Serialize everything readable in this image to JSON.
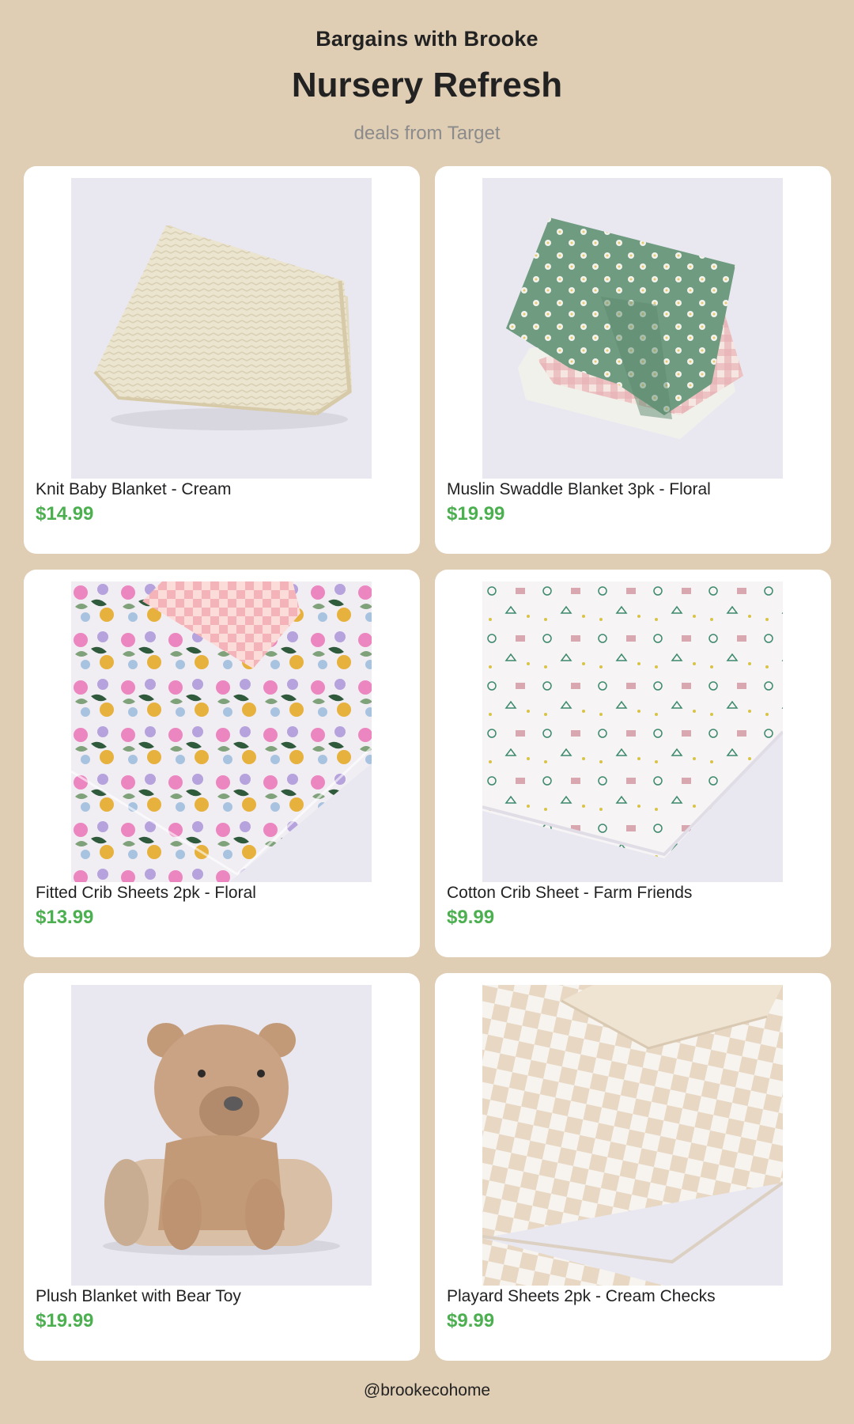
{
  "header": {
    "brand": "Bargains with Brooke",
    "title": "Nursery Refresh",
    "subtitle": "deals from Target"
  },
  "products": [
    {
      "name": "Knit Baby Blanket - Cream",
      "price": "$14.99",
      "image": "knit-blanket-image"
    },
    {
      "name": "Muslin Swaddle Blanket 3pk - Floral",
      "price": "$19.99",
      "image": "swaddle-blankets-image"
    },
    {
      "name": "Fitted Crib Sheets 2pk - Floral",
      "price": "$13.99",
      "image": "floral-crib-sheet-image"
    },
    {
      "name": "Cotton Crib Sheet - Farm Friends",
      "price": "$9.99",
      "image": "farm-crib-sheet-image"
    },
    {
      "name": "Plush Blanket with Bear Toy",
      "price": "$19.99",
      "image": "bear-blanket-image"
    },
    {
      "name": "Playard Sheets 2pk - Cream Checks",
      "price": "$9.99",
      "image": "checks-playard-sheet-image"
    }
  ],
  "footer": {
    "handle": "@brookecohome"
  },
  "colors": {
    "background": "#dfcdb4",
    "price": "#4caf50",
    "card": "#ffffff"
  }
}
